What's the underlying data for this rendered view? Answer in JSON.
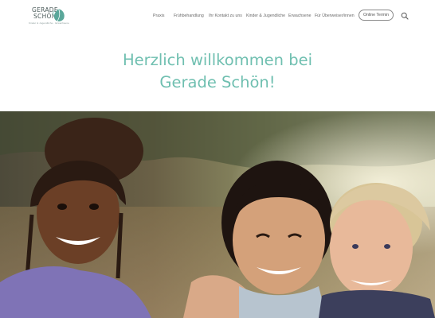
{
  "logo": {
    "line1": "GERADE",
    "line2": "SCHÖN",
    "tagline": "Kinder & Jugendliche · Erwachsene",
    "leaf_color": "#5aa79a"
  },
  "nav": {
    "items": [
      {
        "label": "Praxis"
      },
      {
        "label": "Frühbehandlung"
      },
      {
        "label": "Ihr Kontakt zu uns"
      },
      {
        "label": "Kinder & Jugendliche"
      },
      {
        "label": "Erwachsene"
      },
      {
        "label": "Für Überweiser/innen"
      }
    ],
    "cta_label": "Online Termin",
    "search_icon": "search-icon"
  },
  "hero": {
    "title_line1": "Herzlich willkommen bei",
    "title_line2": "Gerade Schön!",
    "title_color": "#6fbfb0",
    "image_alt": "Lachende Kinder"
  }
}
